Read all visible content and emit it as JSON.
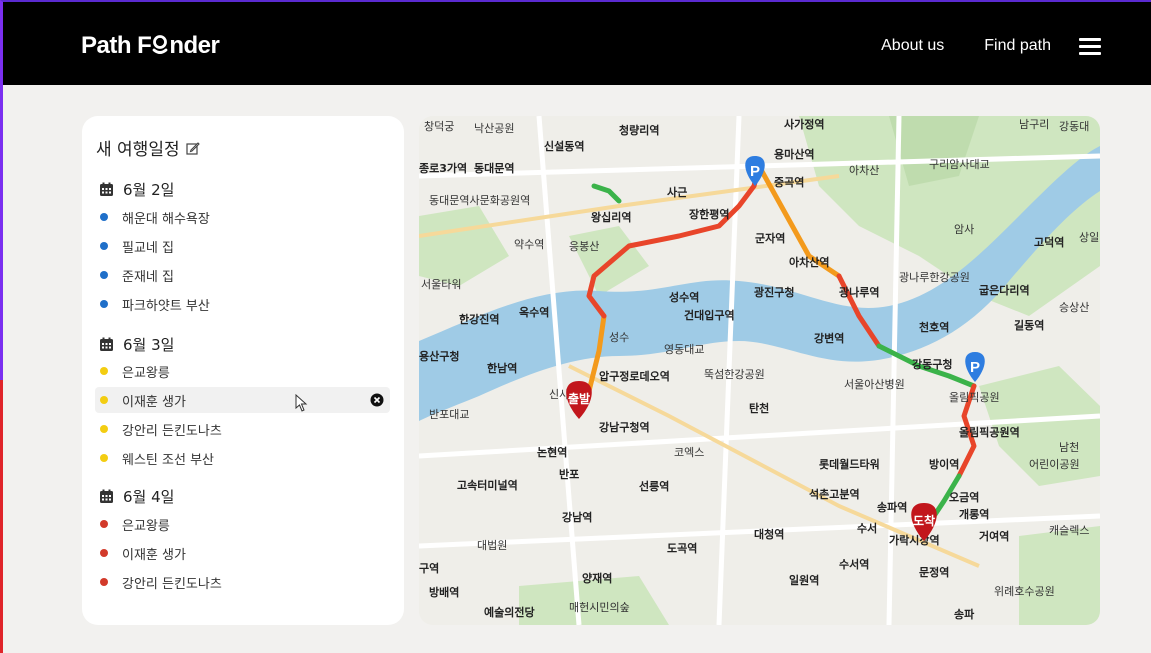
{
  "header": {
    "logo": "Path F♉nder",
    "nav": [
      {
        "label": "About us"
      },
      {
        "label": "Find path"
      }
    ]
  },
  "itinerary": {
    "title": "새 여행일정",
    "days": [
      {
        "label": "6월 2일",
        "color": "#1f6fc9",
        "stops": [
          "해운대 해수욕장",
          "필교네 집",
          "준재네 집",
          "파크하얏트 부산"
        ]
      },
      {
        "label": "6월 3일",
        "color": "#f3cd12",
        "stops": [
          "은교왕릉",
          "이재훈 생가",
          "강안리 든킨도나츠",
          "웨스틴 조선 부산"
        ]
      },
      {
        "label": "6월 4일",
        "color": "#d23a2a",
        "stops": [
          "은교왕릉",
          "이재훈 생가",
          "강안리 든킨도나츠"
        ]
      }
    ]
  },
  "map": {
    "start_marker": "출발",
    "end_marker": "도착",
    "parking_marker": "P",
    "route_colors": {
      "heavy": "#e8452a",
      "medium": "#f39a1c",
      "light": "#3bb34a"
    },
    "labels": [
      "창덕궁",
      "낙산공원",
      "신설동역",
      "청량리역",
      "사가정역",
      "용마산역",
      "아차산",
      "구리암사대교",
      "남구리",
      "강동대",
      "종로3가역",
      "동대문역",
      "동대문역사문화공원역",
      "왕십리역",
      "사근",
      "장한평역",
      "중곡역",
      "군자역",
      "아차산역",
      "암사",
      "고덕역",
      "상일",
      "약수역",
      "응봉산",
      "서울타워",
      "성수역",
      "광진구청",
      "광나루역",
      "광나루한강공원",
      "굽은다리역",
      "승상산",
      "한강진역",
      "옥수역",
      "건대입구역",
      "천호역",
      "길동역",
      "성수",
      "영동대교",
      "강변역",
      "용산구청",
      "한남역",
      "압구정로데오역",
      "뚝섬한강공원",
      "서울아산병원",
      "강동구청",
      "반포대교",
      "신사",
      "탄천",
      "올림픽공원",
      "강남구청역",
      "올림픽공원역",
      "남천",
      "어린이공원",
      "논현역",
      "코엑스",
      "롯데월드타워",
      "방이역",
      "고속터미널역",
      "반포",
      "선릉역",
      "석촌고분역",
      "송파역",
      "오금역",
      "개롱역",
      "강남역",
      "대법원",
      "도곡역",
      "대청역",
      "수서",
      "가락시장역",
      "거여역",
      "캐슬렉스",
      "구역",
      "양재역",
      "수서역",
      "문정역",
      "방배역",
      "예술의전당",
      "매헌시민의숲",
      "일원역",
      "위례호수공원",
      "송파"
    ]
  }
}
